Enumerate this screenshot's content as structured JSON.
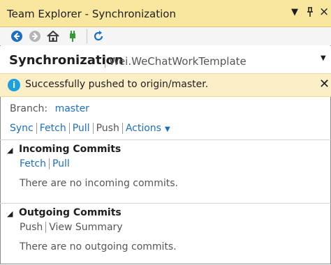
{
  "window": {
    "title": "Team Explorer - Synchronization",
    "controls": [
      "▼",
      "⊥",
      "×"
    ]
  },
  "toolbar": {
    "buttons": [
      "back-icon",
      "forward-icon",
      "home-icon",
      "connect-icon",
      "refresh-icon"
    ]
  },
  "header": {
    "title": "Synchronization",
    "subtitle": "Wei.WeChatWorkTemplate"
  },
  "notification": {
    "message": "Successfully pushed to origin/master.",
    "icon": "i"
  },
  "branch": {
    "label": "Branch:",
    "value": "master"
  },
  "actions": {
    "sync": "Sync",
    "fetch": "Fetch",
    "pull": "Pull",
    "push": "Push",
    "more": "Actions"
  },
  "incoming": {
    "title": "Incoming Commits",
    "fetch": "Fetch",
    "pull": "Pull",
    "empty": "There are no incoming commits."
  },
  "outgoing": {
    "title": "Outgoing Commits",
    "push": "Push",
    "view_summary": "View Summary",
    "empty": "There are no outgoing commits."
  },
  "colors": {
    "title_bar": "#f9e79f",
    "info_bar": "#fcefc8",
    "link": "#1e6fc0",
    "info_icon": "#1ba1e2"
  }
}
